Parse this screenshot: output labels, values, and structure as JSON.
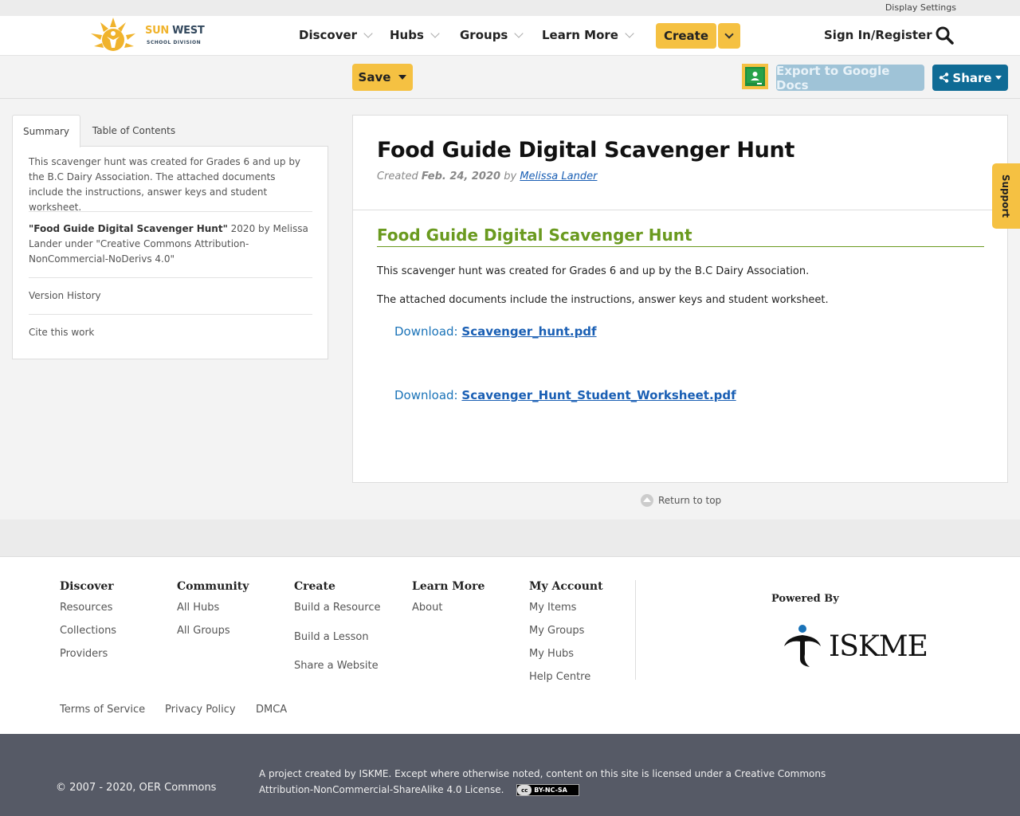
{
  "utility": {
    "display_settings": "Display Settings"
  },
  "logo": {
    "line1a": "SUN",
    "line1b": "WEST",
    "line2": "SCHOOL DIVISION"
  },
  "nav": {
    "discover": "Discover",
    "hubs": "Hubs",
    "groups": "Groups",
    "learn_more": "Learn More",
    "create": "Create",
    "signin": "Sign In/Register"
  },
  "actions": {
    "save": "Save",
    "export": "Export to Google Docs",
    "share": "Share"
  },
  "sidebar": {
    "tabs": [
      "Summary",
      "Table of Contents"
    ],
    "summary": "This scavenger hunt was created for Grades 6 and up by the B.C Dairy Association. The attached documents include the instructions, answer keys and student worksheet.",
    "attribution_title": "\"Food Guide Digital Scavenger Hunt\"",
    "attribution_rest": " 2020 by Melissa Lander under \"Creative Commons Attribution-NonCommercial-NoDerivs 4.0\"",
    "version_history": "Version History",
    "cite": "Cite this work"
  },
  "resource": {
    "title": "Food Guide Digital Scavenger Hunt",
    "created_label": "Created",
    "created_date": "Feb. 24, 2020",
    "by_label": "by",
    "author": "Melissa Lander",
    "section_heading": "Food Guide Digital Scavenger Hunt",
    "para1": "This scavenger hunt was created for Grades 6 and up by the B.C Dairy Association.",
    "para2": "The attached documents include the instructions, answer keys and student worksheet.",
    "download_label": "Download:",
    "file1": "Scavenger_hunt.pdf",
    "file2": "Scavenger_Hunt_Student_Worksheet.pdf"
  },
  "support": "Support",
  "return_top": "Return to top",
  "footer": {
    "discover": {
      "title": "Discover",
      "links": [
        "Resources",
        "Collections",
        "Providers"
      ]
    },
    "community": {
      "title": "Community",
      "links": [
        "All Hubs",
        "All Groups"
      ]
    },
    "create": {
      "title": "Create",
      "links": [
        "Build a Resource",
        "Build a Lesson",
        "Share a Website"
      ]
    },
    "learn_more": {
      "title": "Learn More",
      "links": [
        "About"
      ]
    },
    "my_account": {
      "title": "My Account",
      "links": [
        "My Items",
        "My Groups",
        "My Hubs",
        "Help Centre"
      ]
    },
    "powered_by": "Powered By",
    "iskme": "ISKME",
    "legal": [
      "Terms of Service",
      "Privacy Policy",
      "DMCA"
    ]
  },
  "bottom": {
    "copyright": "© 2007 - 2020, OER Commons",
    "license": "A project created by ISKME. Except where otherwise noted, content on this site is licensed under a Creative Commons Attribution-NonCommercial-ShareAlike 4.0 License.",
    "cc_badge": "BY-NC-SA",
    "cc_mark": "cc"
  },
  "colors": {
    "accent_yellow": "#f5c142",
    "share_blue": "#0f6b95",
    "export_blue": "#9fc3d7",
    "section_green": "#6a9a1f",
    "link_blue": "#1a5fb4",
    "footer_bar": "#565a66"
  }
}
